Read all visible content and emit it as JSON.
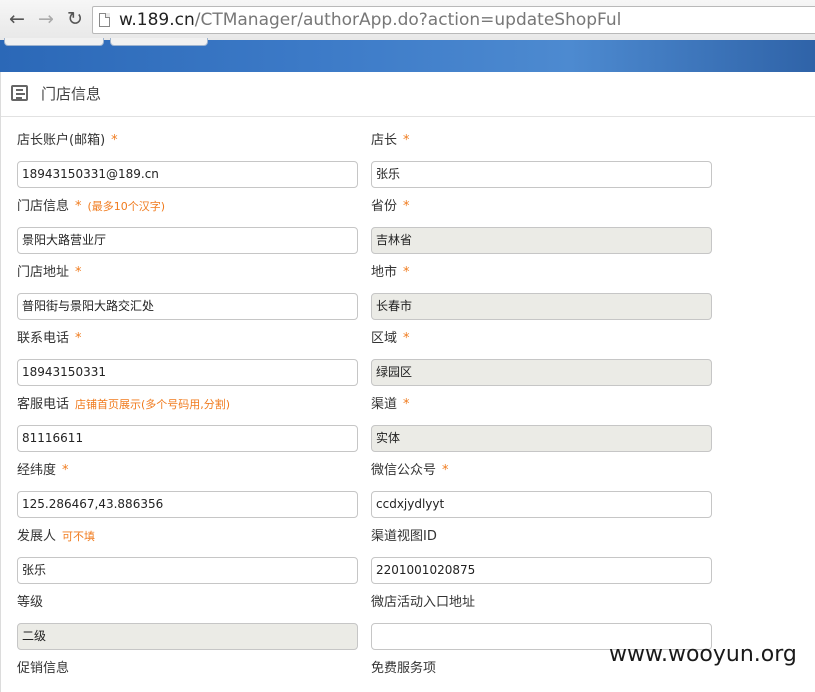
{
  "browser": {
    "back_icon": "back-arrow-icon",
    "forward_icon": "forward-arrow-icon",
    "reload_icon": "reload-icon",
    "url_host": "w.189.cn",
    "url_path": "/CTManager/authorApp.do?action=updateShopFul"
  },
  "panel": {
    "title": "门店信息",
    "icon": "list-icon"
  },
  "fields": [
    {
      "id": "shop-owner-account",
      "label": "店长账户(邮箱)",
      "req": "*",
      "hint": "",
      "value": "18943150331@189.cn",
      "readonly": false
    },
    {
      "id": "shop-owner",
      "label": "店长",
      "req": "*",
      "hint": "",
      "value": "张乐",
      "readonly": false
    },
    {
      "id": "shop-info",
      "label": "门店信息",
      "req": "*",
      "hint": "(最多10个汉字)",
      "value": "景阳大路营业厅",
      "readonly": false
    },
    {
      "id": "province",
      "label": "省份",
      "req": "*",
      "hint": "",
      "value": "吉林省",
      "readonly": true
    },
    {
      "id": "shop-address",
      "label": "门店地址",
      "req": "*",
      "hint": "",
      "value": "普阳街与景阳大路交汇处",
      "readonly": false
    },
    {
      "id": "city",
      "label": "地市",
      "req": "*",
      "hint": "",
      "value": "长春市",
      "readonly": true
    },
    {
      "id": "contact-phone",
      "label": "联系电话",
      "req": "*",
      "hint": "",
      "value": "18943150331",
      "readonly": false
    },
    {
      "id": "district",
      "label": "区域",
      "req": "*",
      "hint": "",
      "value": "绿园区",
      "readonly": true
    },
    {
      "id": "service-phone",
      "label": "客服电话",
      "req": "",
      "hint": "店铺首页展示(多个号码用,分割)",
      "value": "81116611",
      "readonly": false
    },
    {
      "id": "channel",
      "label": "渠道",
      "req": "*",
      "hint": "",
      "value": "实体",
      "readonly": true
    },
    {
      "id": "coordinates",
      "label": "经纬度",
      "req": "*",
      "hint": "",
      "value": "125.286467,43.886356",
      "readonly": false
    },
    {
      "id": "wechat-account",
      "label": "微信公众号",
      "req": "*",
      "hint": "",
      "value": "ccdxjydlyyt",
      "readonly": false
    },
    {
      "id": "developer",
      "label": "发展人",
      "req": "",
      "hint": "可不填",
      "value": "张乐",
      "readonly": false
    },
    {
      "id": "channel-view-id",
      "label": "渠道视图ID",
      "req": "",
      "hint": "",
      "value": "2201001020875",
      "readonly": false
    },
    {
      "id": "level",
      "label": "等级",
      "req": "",
      "hint": "",
      "value": "二级",
      "readonly": true
    },
    {
      "id": "activity-url",
      "label": "微店活动入口地址",
      "req": "",
      "hint": "",
      "value": "",
      "readonly": false
    },
    {
      "id": "promotion-info",
      "label": "促销信息",
      "req": "",
      "hint": "",
      "value": null,
      "readonly": false
    },
    {
      "id": "free-services",
      "label": "免费服务项",
      "req": "",
      "hint": "",
      "value": null,
      "readonly": false
    }
  ],
  "watermark": "www.wooyun.org",
  "colors": {
    "accent": "#f07b1e",
    "banner": "#3d7bc8",
    "readonly_bg": "#ebebe6"
  }
}
